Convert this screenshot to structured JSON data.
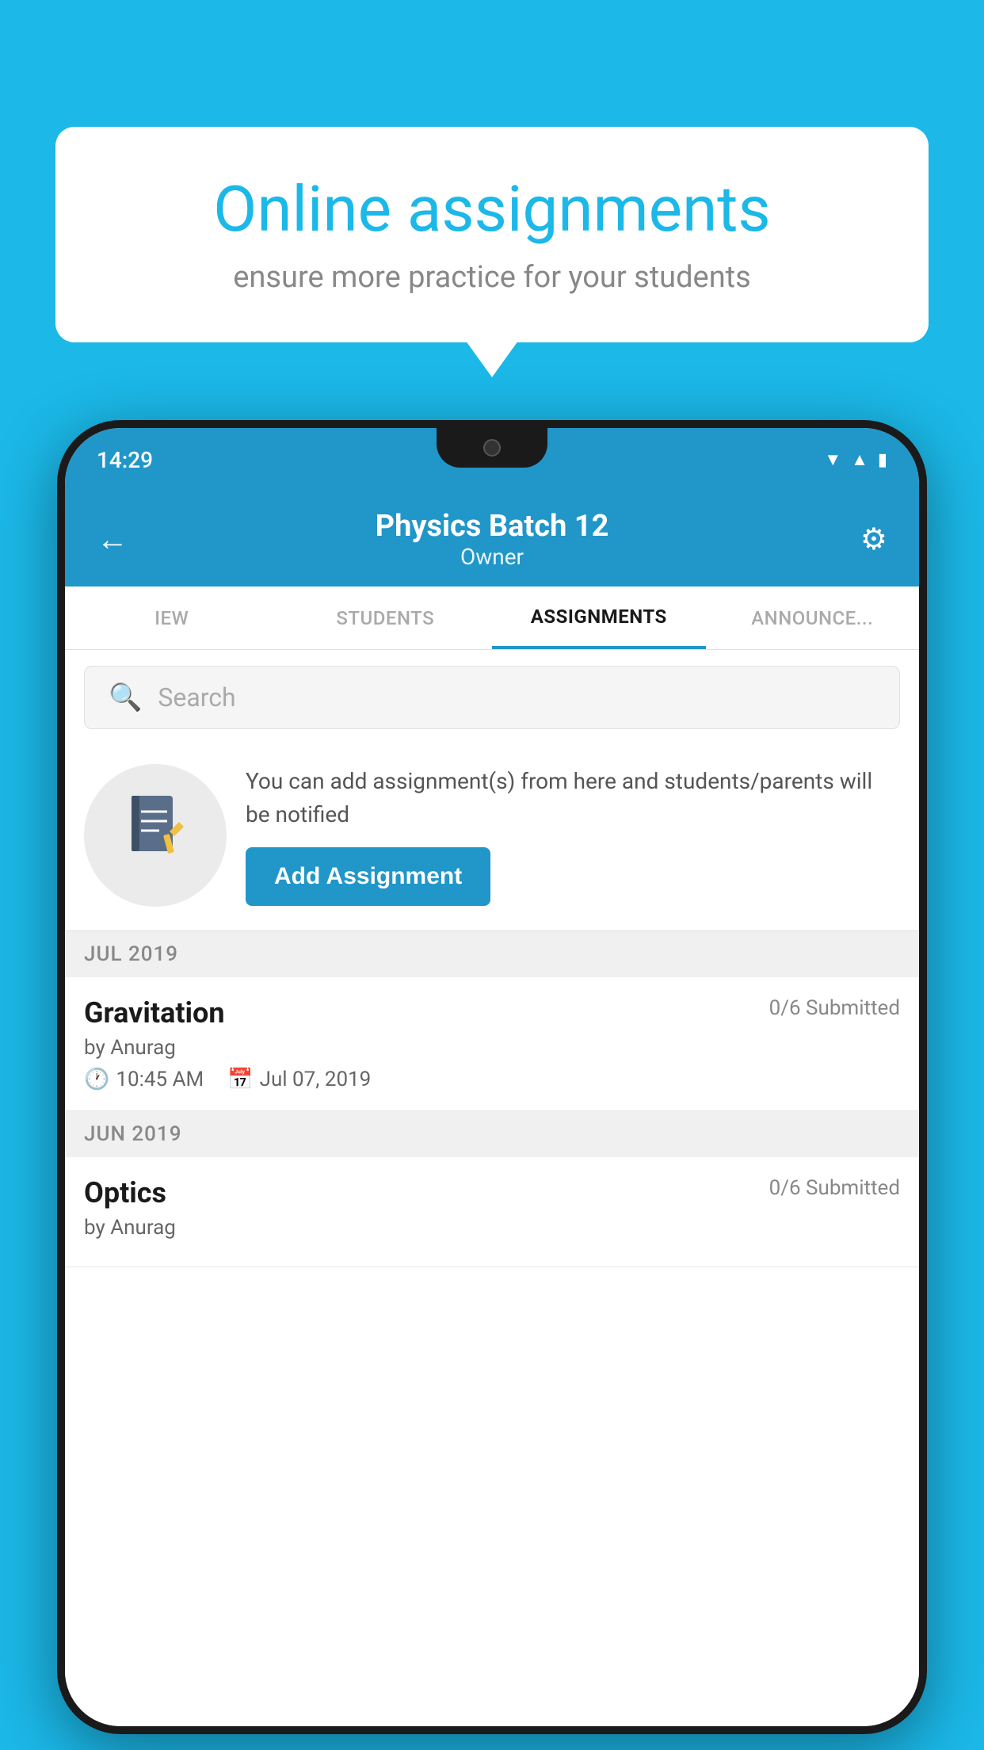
{
  "background_color": "#1BB8E8",
  "speech_bubble": {
    "title": "Online assignments",
    "subtitle": "ensure more practice for your students"
  },
  "status_bar": {
    "time": "14:29",
    "icons": [
      "wifi",
      "signal",
      "battery"
    ]
  },
  "app_header": {
    "title": "Physics Batch 12",
    "subtitle": "Owner",
    "back_label": "←",
    "gear_label": "⚙"
  },
  "tabs": [
    {
      "label": "IEW",
      "active": false
    },
    {
      "label": "STUDENTS",
      "active": false
    },
    {
      "label": "ASSIGNMENTS",
      "active": true
    },
    {
      "label": "ANNOUNCEMENTS",
      "active": false
    }
  ],
  "search": {
    "placeholder": "Search"
  },
  "promo": {
    "text": "You can add assignment(s) from here and students/parents will be notified",
    "button_label": "Add Assignment"
  },
  "sections": [
    {
      "month": "JUL 2019",
      "assignments": [
        {
          "name": "Gravitation",
          "submitted": "0/6 Submitted",
          "by": "by Anurag",
          "time": "10:45 AM",
          "date": "Jul 07, 2019"
        }
      ]
    },
    {
      "month": "JUN 2019",
      "assignments": [
        {
          "name": "Optics",
          "submitted": "0/6 Submitted",
          "by": "by Anurag",
          "time": "",
          "date": ""
        }
      ]
    }
  ]
}
